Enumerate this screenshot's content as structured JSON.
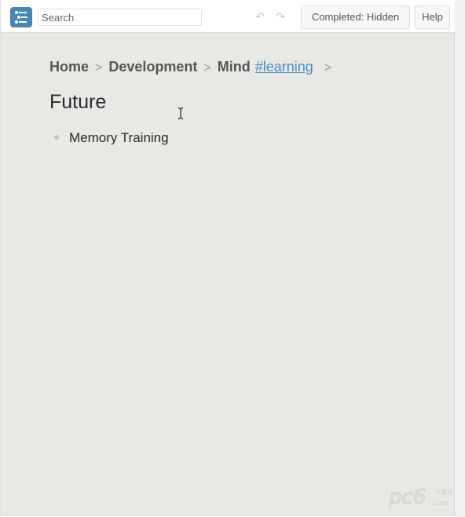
{
  "toolbar": {
    "search_placeholder": "Search",
    "completed_label": "Completed: Hidden",
    "help_label": "Help"
  },
  "breadcrumb": {
    "items": [
      "Home",
      "Development",
      "Mind"
    ],
    "tag": "#learning",
    "separator": ">"
  },
  "page": {
    "title": "Future",
    "items": [
      {
        "label": "Memory Training"
      }
    ]
  },
  "watermark": {
    "text": "pc6"
  },
  "colors": {
    "accent": "#4a86b4",
    "tag_link": "#4a90c0",
    "background": "#e8e8e4"
  }
}
